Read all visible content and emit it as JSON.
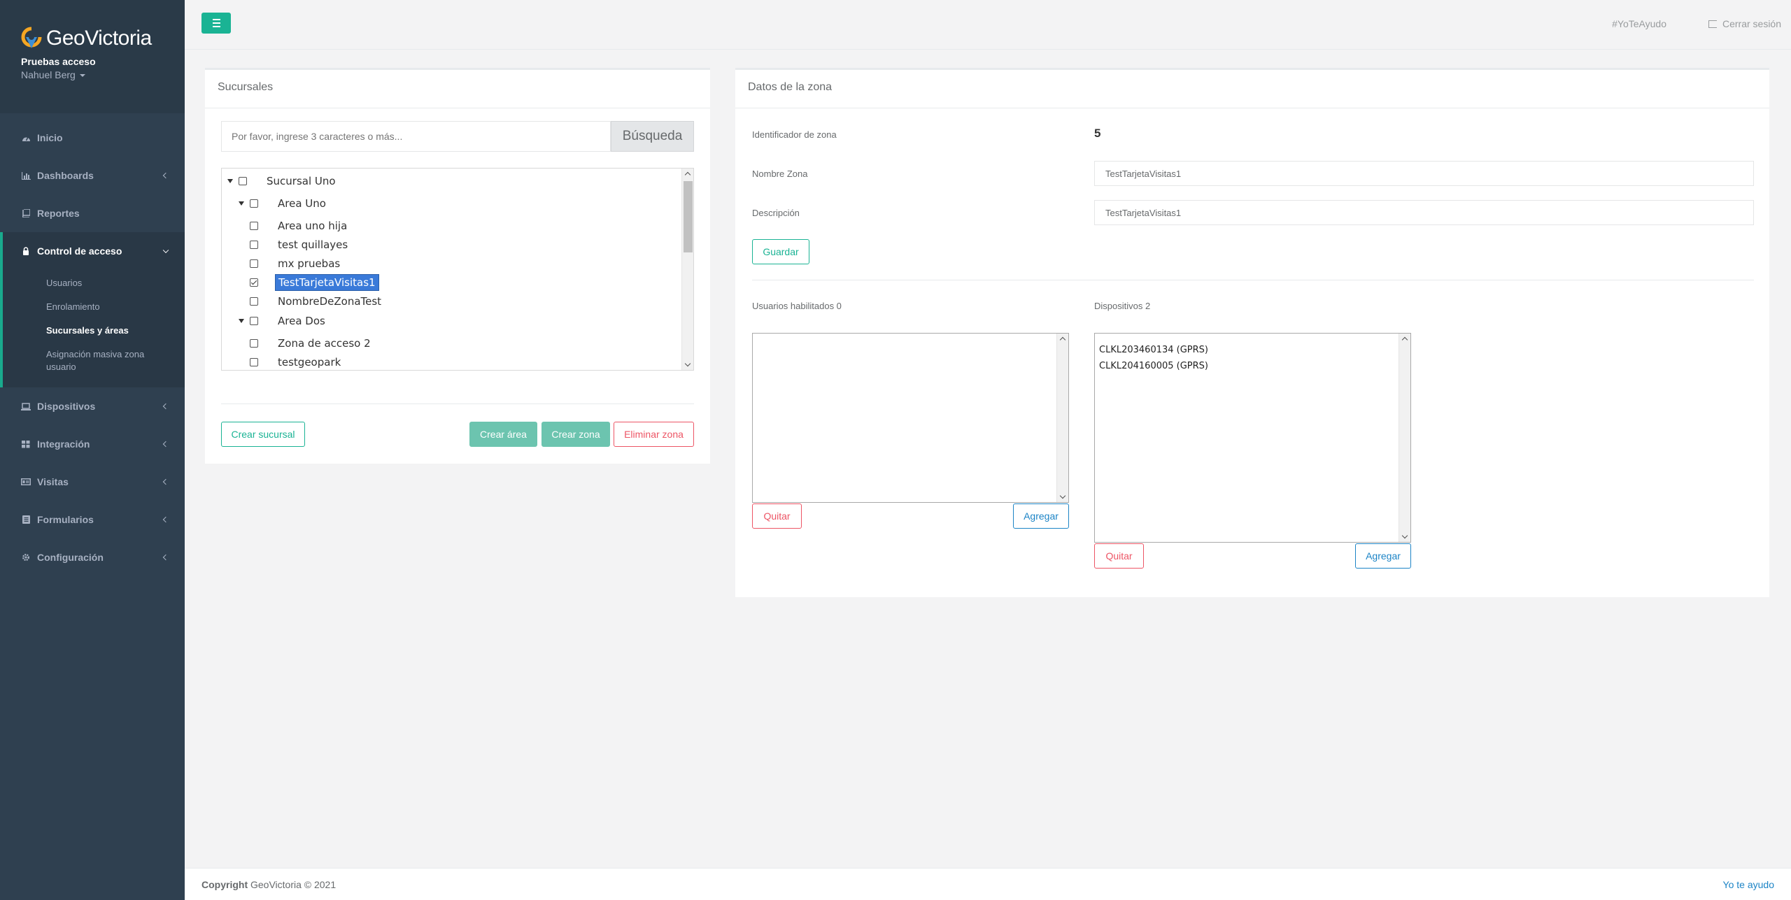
{
  "brand": {
    "name": "GeoVictoria",
    "account": "Pruebas acceso",
    "user": "Nahuel Berg"
  },
  "icons": {
    "dashboard": "gauge-icon",
    "chart": "bar-chart-icon",
    "book": "book-icon",
    "lock": "lock-icon",
    "laptop": "laptop-icon",
    "grid": "grid-icon",
    "card": "id-card-icon",
    "list": "list-icon",
    "gear": "gear-icon"
  },
  "colors": {
    "accent": "#1ab394",
    "sidebar": "#2f4050",
    "danger": "#ed5565",
    "primary": "#1c84c6",
    "selected": "#3a7ad9"
  },
  "sidebar": {
    "items": [
      {
        "label": "Inicio"
      },
      {
        "label": "Dashboards"
      },
      {
        "label": "Reportes"
      },
      {
        "label": "Control de acceso"
      },
      {
        "label": "Dispositivos"
      },
      {
        "label": "Integración"
      },
      {
        "label": "Visitas"
      },
      {
        "label": "Formularios"
      },
      {
        "label": "Configuración"
      }
    ],
    "subitems": [
      {
        "label": "Usuarios"
      },
      {
        "label": "Enrolamiento"
      },
      {
        "label": "Sucursales y áreas"
      },
      {
        "label": "Asignación masiva zona usuario"
      }
    ]
  },
  "topbar": {
    "help": "#YoTeAyudo",
    "logout": "Cerrar sesión"
  },
  "branches": {
    "title": "Sucursales",
    "search_placeholder": "Por favor, ingrese 3 caracteres o más...",
    "search_button": "Búsqueda",
    "tree": [
      {
        "label": "Sucursal Uno",
        "checked": false
      },
      {
        "label": "Area Uno",
        "checked": false
      },
      {
        "label": "Area uno hija",
        "checked": false
      },
      {
        "label": "test quillayes",
        "checked": false
      },
      {
        "label": "mx pruebas",
        "checked": false
      },
      {
        "label": "TestTarjetaVisitas1",
        "checked": true
      },
      {
        "label": "NombreDeZonaTest",
        "checked": false
      },
      {
        "label": "Area Dos",
        "checked": false
      },
      {
        "label": "Zona de acceso 2",
        "checked": false
      },
      {
        "label": "testgeopark",
        "checked": false
      }
    ],
    "create_branch": "Crear sucursal",
    "create_area": "Crear área",
    "create_zone": "Crear zona",
    "delete_zone": "Eliminar zona"
  },
  "zone": {
    "title": "Datos de la zona",
    "id_label": "Identificador de zona",
    "id_value": "5",
    "name_label": "Nombre Zona",
    "name_value": "TestTarjetaVisitas1",
    "desc_label": "Descripción",
    "desc_value": "TestTarjetaVisitas1",
    "save": "Guardar",
    "users_label": "Usuarios habilitados 0",
    "users": [],
    "devices_label": "Dispositivos 2",
    "devices": [
      "CLKL203460134 (GPRS)",
      "CLKL204160005 (GPRS)"
    ],
    "remove": "Quitar",
    "add": "Agregar"
  },
  "footer": {
    "copyright": "Copyright",
    "company": "GeoVictoria © 2021",
    "help_link": "Yo te ayudo"
  }
}
